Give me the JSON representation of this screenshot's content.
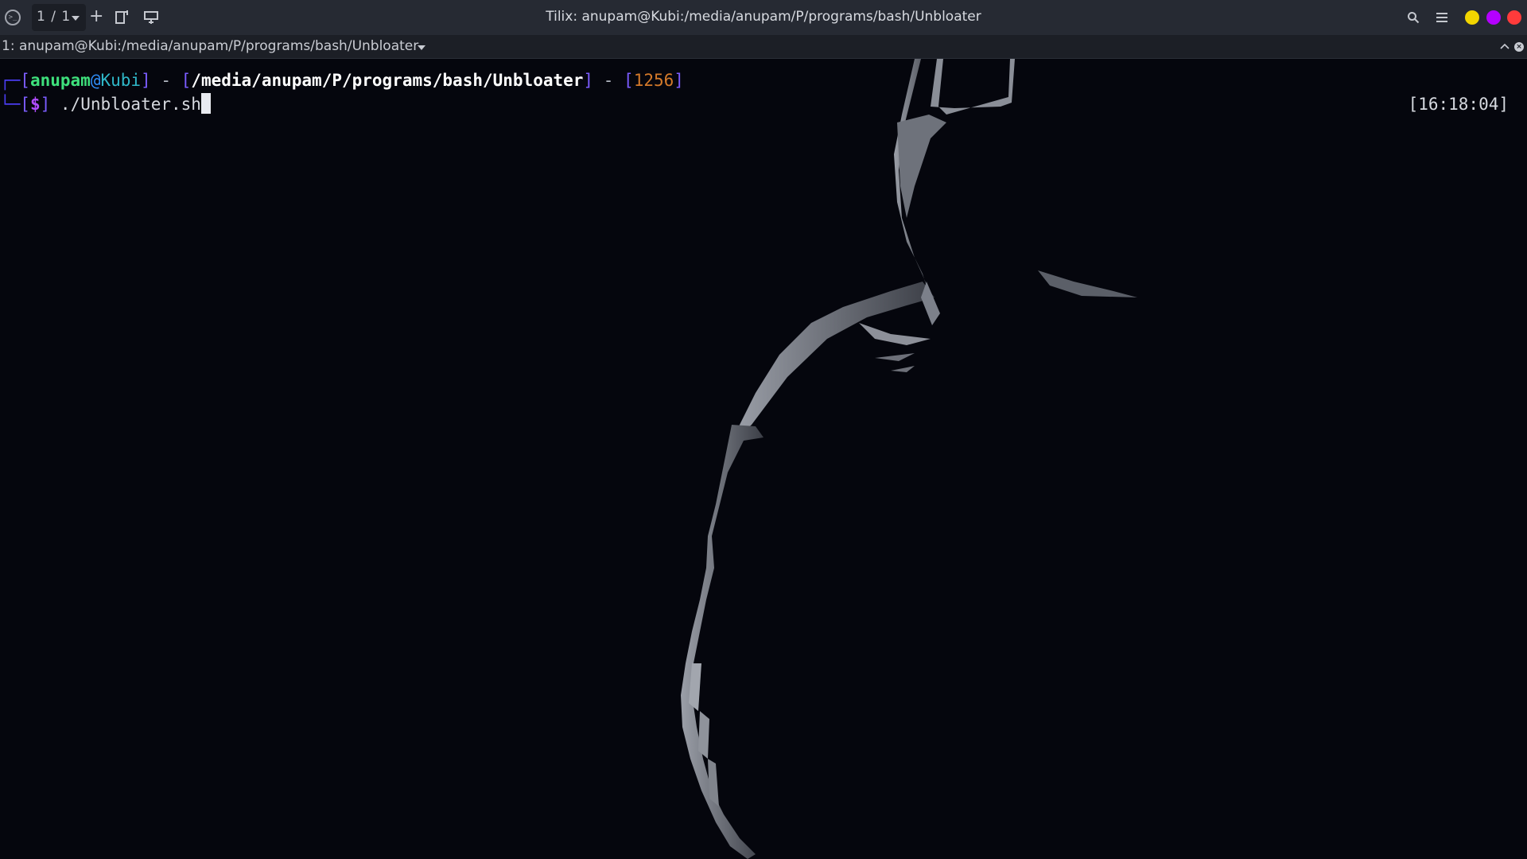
{
  "header": {
    "window_title": "Tilix: anupam@Kubi:/media/anupam/P/programs/bash/Unbloater",
    "session_count": "1 / 1",
    "add_session": "+",
    "icons": [
      "terminal-app-icon",
      "split-right-icon",
      "split-down-icon",
      "search-icon",
      "hamburger-menu-icon"
    ],
    "window_buttons": {
      "minimize_color": "#f2d500",
      "maximize_color": "#b400ff",
      "close_color": "#ff3b3b"
    }
  },
  "terminal_title": "1: anupam@Kubi:/media/anupam/P/programs/bash/Unbloater",
  "prompt": {
    "user": "anupam",
    "at": "@",
    "host": "Kubi",
    "path": "/media/anupam/P/programs/bash/Unbloater",
    "count": "1256",
    "sep": "-",
    "dollar": "$",
    "command": "./Unbloater.sh",
    "clock": "[16:18:04]"
  },
  "colors": {
    "background": "#05060d",
    "user": "#3ee07c",
    "host": "#2fb8c9",
    "path": "#ffffff",
    "count": "#d47a2a",
    "dollar": "#b14cff",
    "frame": "#4a3cf0"
  }
}
